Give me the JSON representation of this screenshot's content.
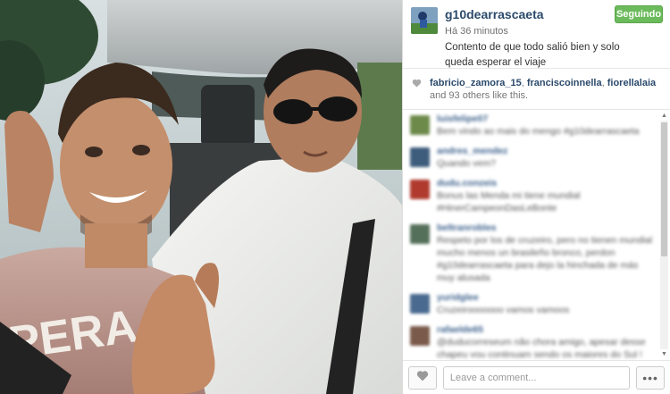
{
  "post": {
    "username": "g10dearrascaeta",
    "time_ago": "Há 36 minutos",
    "caption": "Contento de que todo salió bien y solo queda esperar el viaje",
    "follow_label": "Seguindo"
  },
  "likes": {
    "user1": "fabricio_zamora_15",
    "sep1": ", ",
    "user2": "franciscoinnella",
    "sep2": ", ",
    "user3": "fiorellalaia",
    "rest": " and 93 others like this."
  },
  "comments": [
    {
      "user": "luisfelipe07",
      "text": "Bem vindo ao mais do mengo #g10dearrascaeta"
    },
    {
      "user": "andres_mendez",
      "text": "Quando vem?"
    },
    {
      "user": "dudu.conzeis",
      "text": "Bonus las Menda mi tiene mundial #HinerCampeonDasLeBonte"
    },
    {
      "user": "beltranrobles",
      "text": "Respeto por los de cruzeiro, pero no tienen mundial mucho menos un brasileño bronco, perdon #g10dearrascaeta para dejo la hinchada de más muy alusada"
    },
    {
      "user": "yuridglee",
      "text": "Cruzeirooooooo vamos vamoos"
    },
    {
      "user": "rafaelde65",
      "text": "@duducorreseum não chora amigo, apesar desse chapeu vou continuam sendo os maiores do Sul !"
    }
  ],
  "comment_avatar_colors": [
    "#6d8a4a",
    "#3e5c7c",
    "#b03a2e",
    "#55705a",
    "#4a6a8f",
    "#7a5a4a"
  ],
  "footer": {
    "comment_placeholder": "Leave a comment...",
    "more_label": "•••"
  },
  "colors": {
    "follow_button": "#6bba5b",
    "username": "#2b4a6b"
  },
  "icons": {
    "like": "heart-icon",
    "more": "ellipsis-icon"
  }
}
